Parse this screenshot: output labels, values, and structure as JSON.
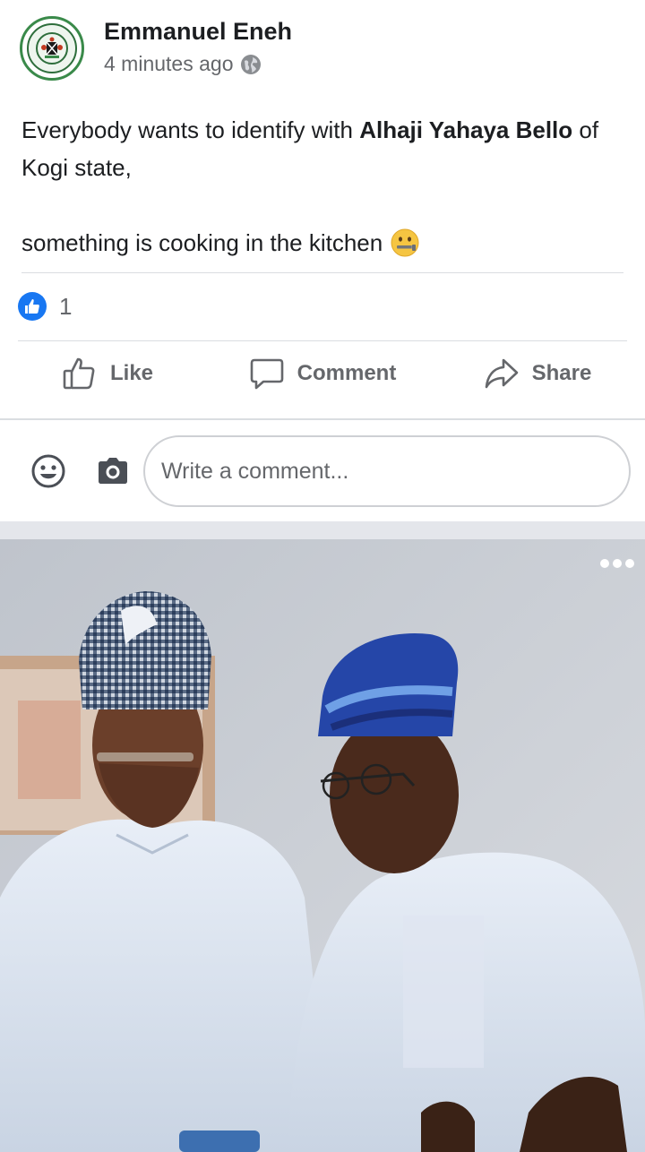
{
  "post": {
    "author": "Emmanuel Eneh",
    "time": "4 minutes ago",
    "text_line1_start": "Everybody wants to identify with ",
    "text_line1_bold": "Alhaji Yahaya Bello",
    "text_line1_end": " of Kogi state,",
    "text_para2": "something is cooking in the kitchen",
    "reaction_count": "1"
  },
  "actions": {
    "like_label": "Like",
    "comment_label": "Comment",
    "share_label": "Share"
  },
  "comment_box": {
    "placeholder": "Write a comment..."
  },
  "icons": {
    "privacy": "globe-icon",
    "reaction": "thumbs-up-icon",
    "emoji": "zipper-mouth-face-icon",
    "smiley": "smiley-icon",
    "camera": "camera-icon",
    "more": "more-options-icon"
  },
  "colors": {
    "brand_blue": "#1877f2",
    "secondary_text": "#65676b",
    "divider": "#dadde1"
  }
}
